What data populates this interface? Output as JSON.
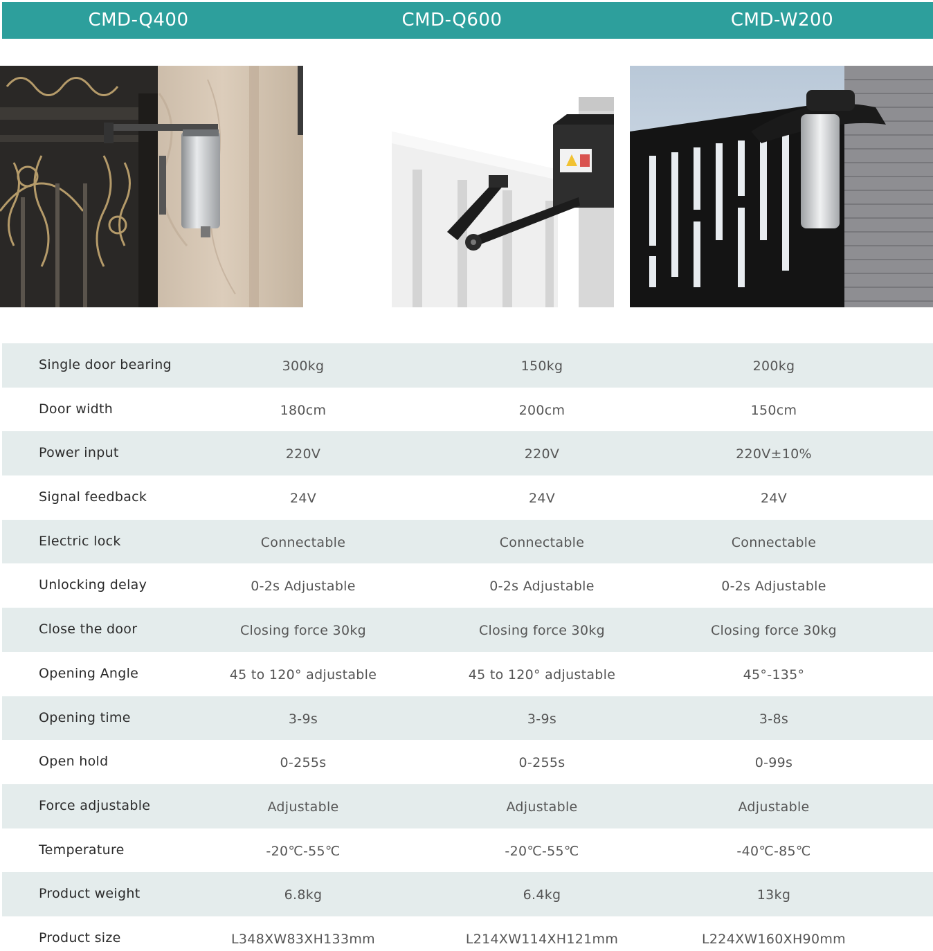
{
  "models": [
    "CMD-Q400",
    "CMD-Q600",
    "CMD-W200"
  ],
  "colors": {
    "header": "#2d9f9c",
    "shaded_row": "#e4ecec"
  },
  "rows": [
    {
      "label": "Single door bearing",
      "values": [
        "300kg",
        "150kg",
        "200kg"
      ]
    },
    {
      "label": "Door width",
      "values": [
        "180cm",
        "200cm",
        "150cm"
      ]
    },
    {
      "label": "Power input",
      "values": [
        "220V",
        "220V",
        "220V±10%"
      ]
    },
    {
      "label": "Signal feedback",
      "values": [
        "24V",
        "24V",
        "24V"
      ]
    },
    {
      "label": "Electric lock",
      "values": [
        "Connectable",
        "Connectable",
        "Connectable"
      ]
    },
    {
      "label": "Unlocking delay",
      "values": [
        "0-2s Adjustable",
        "0-2s Adjustable",
        "0-2s Adjustable"
      ]
    },
    {
      "label": "Close the door",
      "values": [
        "Closing force 30kg",
        "Closing force 30kg",
        "Closing force 30kg"
      ]
    },
    {
      "label": "Opening Angle",
      "values": [
        "45 to 120° adjustable",
        "45 to 120° adjustable",
        "45°-135°"
      ]
    },
    {
      "label": "Opening time",
      "values": [
        "3-9s",
        "3-9s",
        "3-8s"
      ]
    },
    {
      "label": "Open hold",
      "values": [
        "0-255s",
        "0-255s",
        "0-99s"
      ]
    },
    {
      "label": "Force adjustable",
      "values": [
        "Adjustable",
        "Adjustable",
        "Adjustable"
      ]
    },
    {
      "label": "Temperature",
      "values": [
        "-20℃-55℃",
        "-20℃-55℃",
        "-40℃-85℃"
      ]
    },
    {
      "label": "Product weight",
      "values": [
        "6.8kg",
        "6.4kg",
        "13kg"
      ]
    },
    {
      "label": "Product size",
      "values": [
        "L348XW83XH133mm",
        "L214XW114XH121mm",
        "L224XW160XH90mm"
      ]
    }
  ]
}
